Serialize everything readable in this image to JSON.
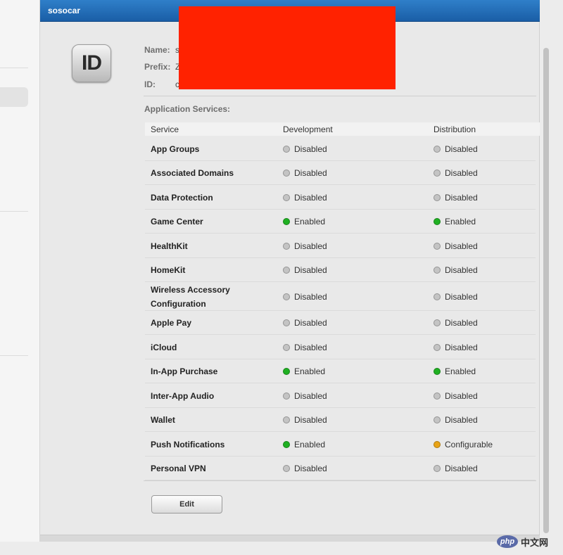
{
  "window": {
    "title": "sosocar"
  },
  "app_id": {
    "icon_text": "ID",
    "fields": [
      {
        "label": "Name:",
        "value": "s"
      },
      {
        "label": "Prefix:",
        "value": "Z"
      },
      {
        "label": "ID:",
        "value": "c"
      }
    ]
  },
  "services": {
    "section_label": "Application Services:",
    "columns": {
      "service": "Service",
      "development": "Development",
      "distribution": "Distribution"
    },
    "rows": [
      {
        "name": "App Groups",
        "development": "Disabled",
        "distribution": "Disabled"
      },
      {
        "name": "Associated Domains",
        "development": "Disabled",
        "distribution": "Disabled"
      },
      {
        "name": "Data Protection",
        "development": "Disabled",
        "distribution": "Disabled"
      },
      {
        "name": "Game Center",
        "development": "Enabled",
        "distribution": "Enabled"
      },
      {
        "name": "HealthKit",
        "development": "Disabled",
        "distribution": "Disabled"
      },
      {
        "name": "HomeKit",
        "development": "Disabled",
        "distribution": "Disabled"
      },
      {
        "name": "Wireless Accessory\nConfiguration",
        "development": "Disabled",
        "distribution": "Disabled"
      },
      {
        "name": "Apple Pay",
        "development": "Disabled",
        "distribution": "Disabled"
      },
      {
        "name": "iCloud",
        "development": "Disabled",
        "distribution": "Disabled"
      },
      {
        "name": "In-App Purchase",
        "development": "Enabled",
        "distribution": "Enabled"
      },
      {
        "name": "Inter-App Audio",
        "development": "Disabled",
        "distribution": "Disabled"
      },
      {
        "name": "Wallet",
        "development": "Disabled",
        "distribution": "Disabled"
      },
      {
        "name": "Push Notifications",
        "development": "Enabled",
        "distribution": "Configurable"
      },
      {
        "name": "Personal VPN",
        "development": "Disabled",
        "distribution": "Disabled"
      }
    ]
  },
  "status_colors": {
    "Disabled": "#c4c4c4",
    "Enabled": "#1fb022",
    "Configurable": "#e8a316"
  },
  "actions": {
    "edit_label": "Edit"
  },
  "watermark": {
    "badge": "php",
    "text": "中文网"
  }
}
